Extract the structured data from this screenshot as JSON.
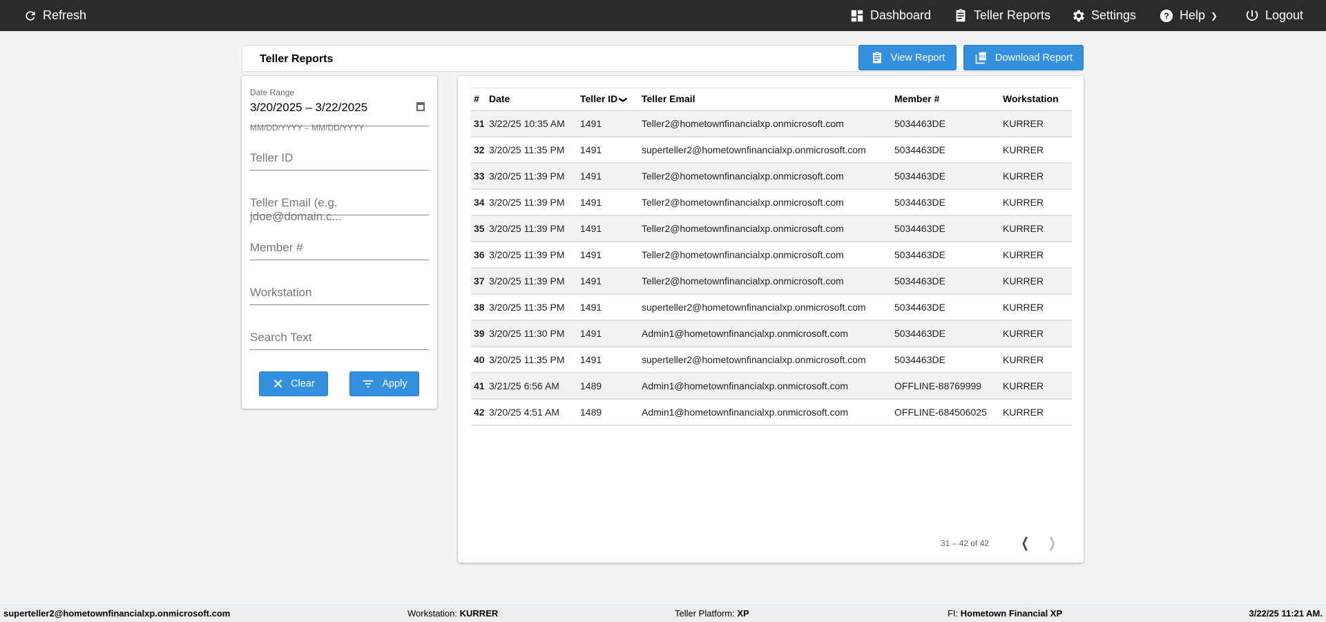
{
  "topbar": {
    "refresh": "Refresh",
    "dashboard": "Dashboard",
    "teller_reports": "Teller Reports",
    "settings": "Settings",
    "help": "Help",
    "logout": "Logout"
  },
  "page": {
    "title": "Teller Reports",
    "view_report": "View Report",
    "download_report": "Download Report"
  },
  "filters": {
    "date_range_label": "Date Range",
    "date_range_value": "3/20/2025 – 3/22/2025",
    "date_hint": "MM/DD/YYYY – MM/DD/YYYY",
    "teller_id_placeholder": "Teller ID",
    "teller_email_placeholder": "Teller Email (e.g. jdoe@domain.c...",
    "member_placeholder": "Member #",
    "workstation_placeholder": "Workstation",
    "search_placeholder": "Search Text",
    "clear": "Clear",
    "apply": "Apply"
  },
  "table": {
    "columns": [
      "#",
      "Date",
      "Teller ID",
      "Teller Email",
      "Member #",
      "Workstation"
    ],
    "sorted_column": "Teller ID",
    "rows": [
      [
        "31",
        "3/22/25 10:35 AM",
        "1491",
        "Teller2@hometownfinancialxp.onmicrosoft.com",
        "5034463DE",
        "KURRER"
      ],
      [
        "32",
        "3/20/25 11:35 PM",
        "1491",
        "superteller2@hometownfinancialxp.onmicrosoft.com",
        "5034463DE",
        "KURRER"
      ],
      [
        "33",
        "3/20/25 11:39 PM",
        "1491",
        "Teller2@hometownfinancialxp.onmicrosoft.com",
        "5034463DE",
        "KURRER"
      ],
      [
        "34",
        "3/20/25 11:39 PM",
        "1491",
        "Teller2@hometownfinancialxp.onmicrosoft.com",
        "5034463DE",
        "KURRER"
      ],
      [
        "35",
        "3/20/25 11:39 PM",
        "1491",
        "Teller2@hometownfinancialxp.onmicrosoft.com",
        "5034463DE",
        "KURRER"
      ],
      [
        "36",
        "3/20/25 11:39 PM",
        "1491",
        "Teller2@hometownfinancialxp.onmicrosoft.com",
        "5034463DE",
        "KURRER"
      ],
      [
        "37",
        "3/20/25 11:39 PM",
        "1491",
        "Teller2@hometownfinancialxp.onmicrosoft.com",
        "5034463DE",
        "KURRER"
      ],
      [
        "38",
        "3/20/25 11:35 PM",
        "1491",
        "superteller2@hometownfinancialxp.onmicrosoft.com",
        "5034463DE",
        "KURRER"
      ],
      [
        "39",
        "3/20/25 11:30 PM",
        "1491",
        "Admin1@hometownfinancialxp.onmicrosoft.com",
        "5034463DE",
        "KURRER"
      ],
      [
        "40",
        "3/20/25 11:35 PM",
        "1491",
        "superteller2@hometownfinancialxp.onmicrosoft.com",
        "5034463DE",
        "KURRER"
      ],
      [
        "41",
        "3/21/25 6:56 AM",
        "1489",
        "Admin1@hometownfinancialxp.onmicrosoft.com",
        "OFFLINE-88769999",
        "KURRER"
      ],
      [
        "42",
        "3/20/25 4:51 AM",
        "1489",
        "Admin1@hometownfinancialxp.onmicrosoft.com",
        "OFFLINE-684506025",
        "KURRER"
      ]
    ],
    "pagination": "31 – 42 of 42"
  },
  "footer": {
    "user": "superteller2@hometownfinancialxp.onmicrosoft.com",
    "workstation_label": "Workstation:",
    "workstation": "KURRER",
    "platform_label": "Teller Platform:",
    "platform": "XP",
    "fi_label": "FI:",
    "fi": "Hometown Financial XP",
    "datetime": "3/22/25 11:21 AM."
  },
  "colors": {
    "topbar": "#2b2b2b",
    "accent": "#3390de"
  }
}
